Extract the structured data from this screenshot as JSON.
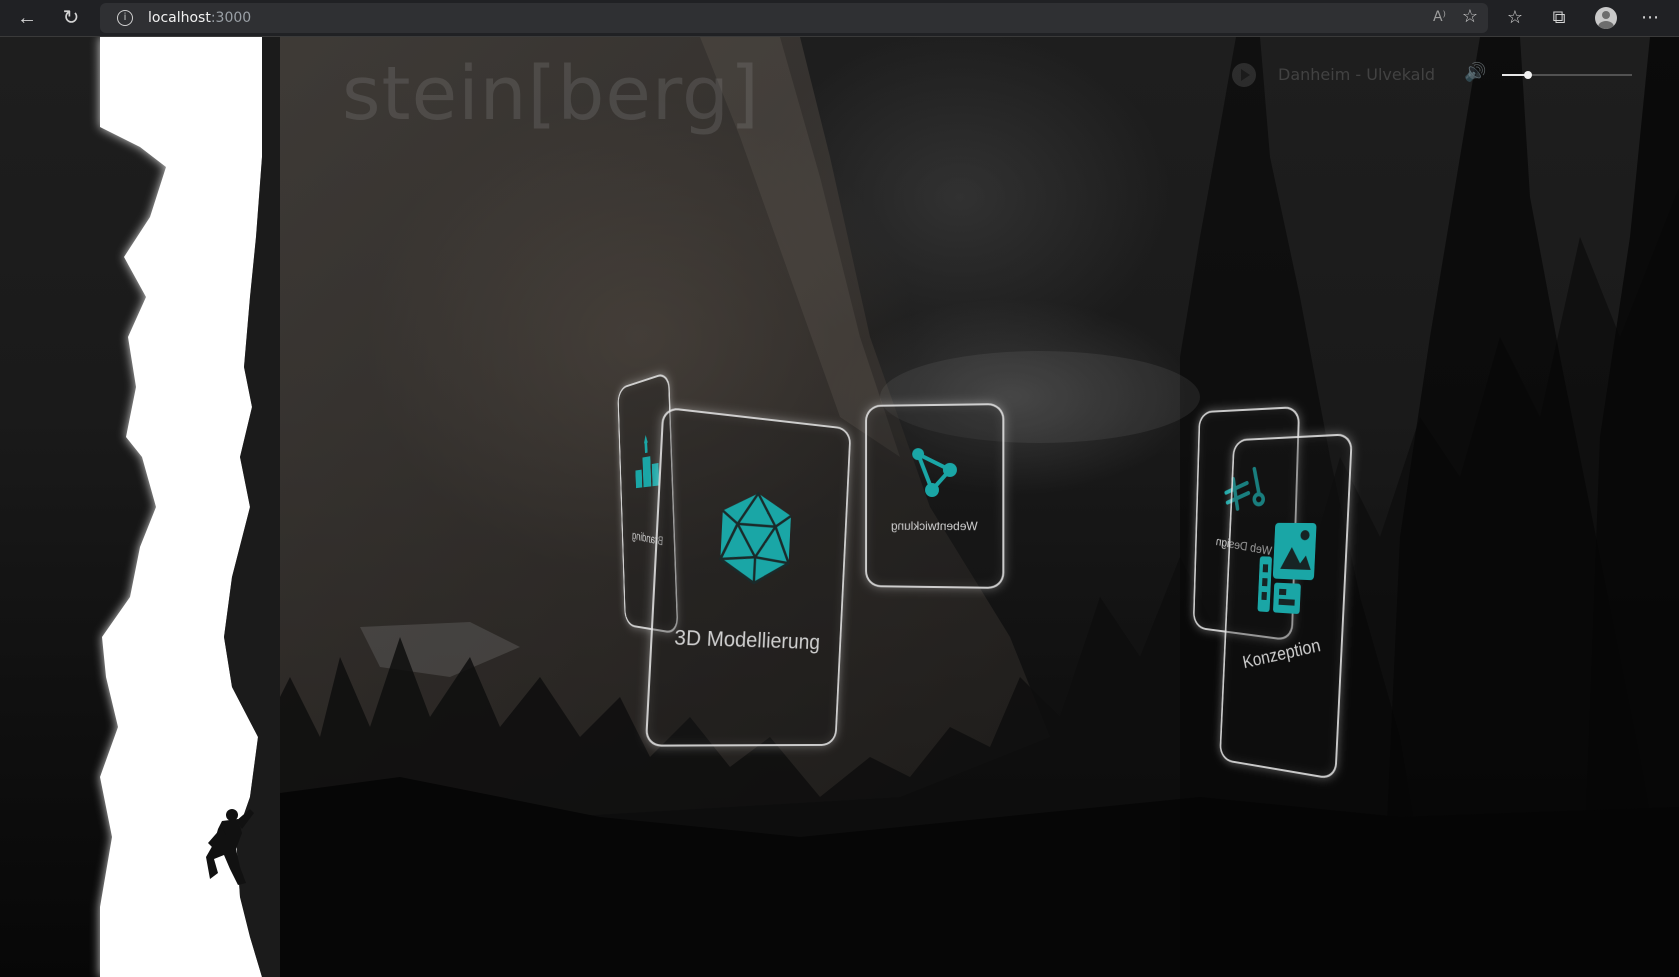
{
  "browser": {
    "url_host": "localhost",
    "url_port": ":3000",
    "read_aloud_label": "A⁾"
  },
  "site": {
    "logo": "stein[berg]"
  },
  "player": {
    "track": "Danheim - Ulvekald",
    "volume_fraction": 0.2
  },
  "cards": [
    {
      "label": "Branding",
      "icon": "podium-icon"
    },
    {
      "label": "3D Modellierung",
      "icon": "icosahedron-icon"
    },
    {
      "label": "Webentwicklung",
      "icon": "network-nodes-icon"
    },
    {
      "label": "Web Design",
      "icon": "design-tools-icon"
    },
    {
      "label": "Konzeption",
      "icon": "layout-image-icon"
    }
  ],
  "colors": {
    "accent": "#1aa6a6",
    "chrome_bg": "#202124",
    "card_border": "#ebebeb"
  }
}
